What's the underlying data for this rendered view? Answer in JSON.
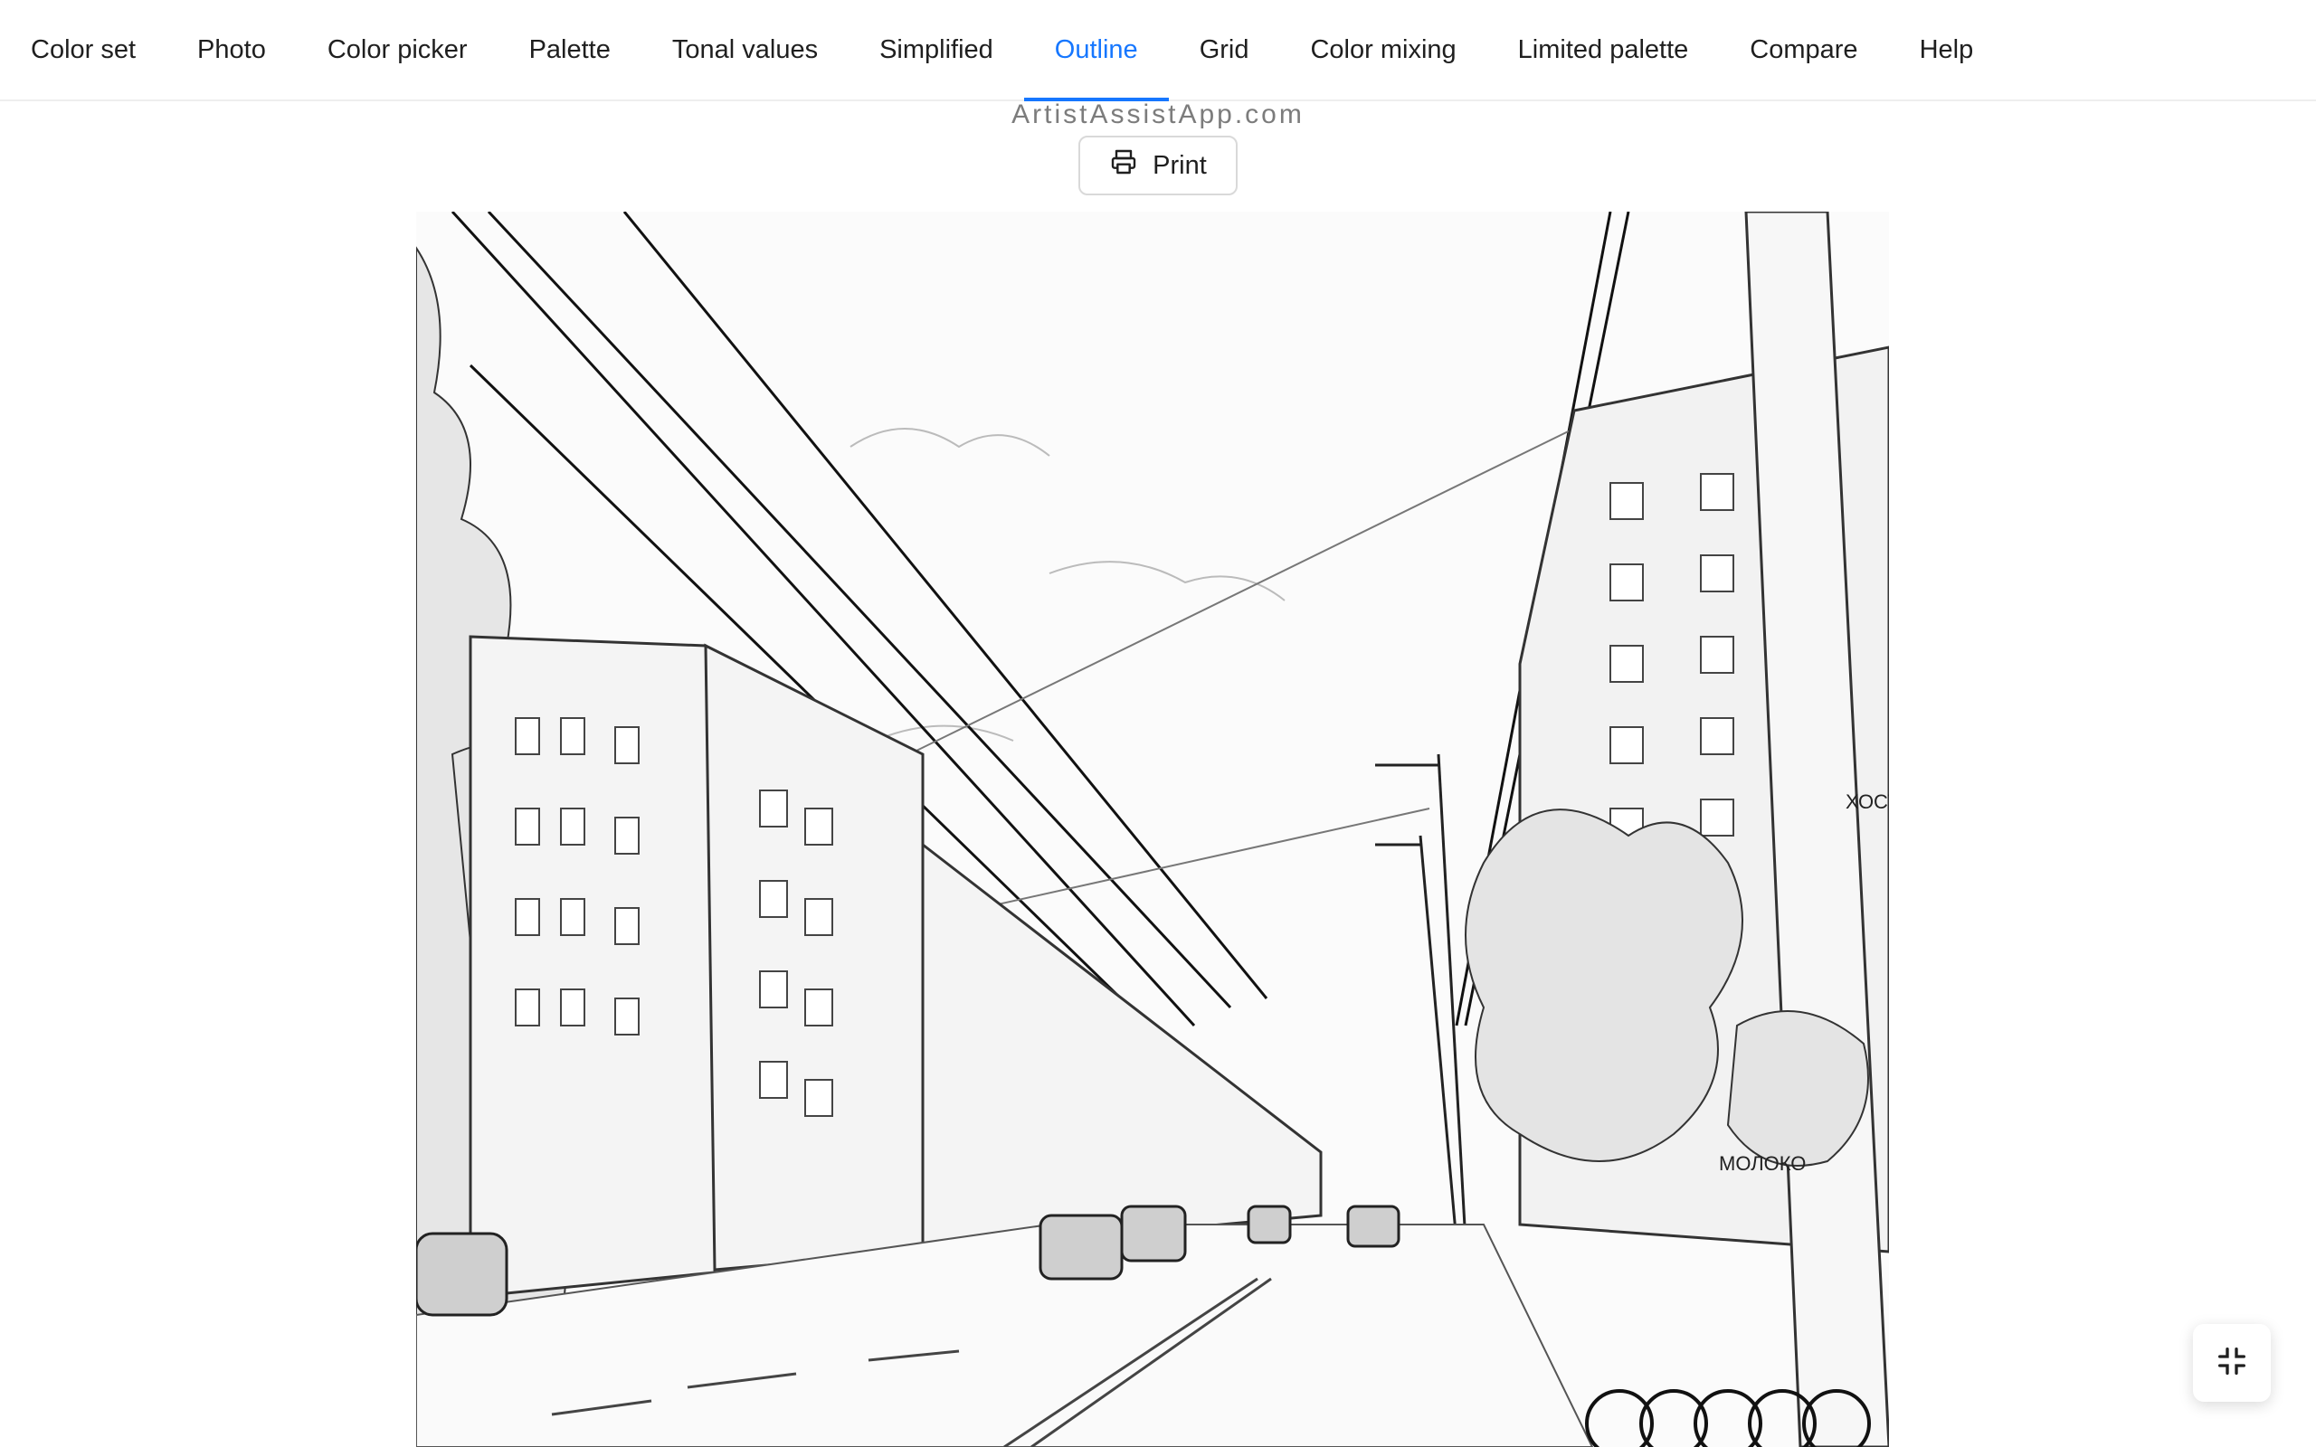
{
  "tabs": [
    {
      "label": "Color set"
    },
    {
      "label": "Photo"
    },
    {
      "label": "Color picker"
    },
    {
      "label": "Palette"
    },
    {
      "label": "Tonal values"
    },
    {
      "label": "Simplified"
    },
    {
      "label": "Outline",
      "active": true
    },
    {
      "label": "Grid"
    },
    {
      "label": "Color mixing"
    },
    {
      "label": "Limited palette"
    },
    {
      "label": "Compare"
    },
    {
      "label": "Help"
    }
  ],
  "watermark": "ArtistAssistApp.com",
  "print_button": {
    "label": "Print",
    "icon": "printer-icon"
  },
  "image": {
    "description_kind": "pencil-outline-sketch",
    "signs": [
      "ХОСТЕЛ",
      "МОЛОКО"
    ]
  },
  "fullscreen_button": {
    "icon": "exit-fullscreen-icon"
  },
  "colors": {
    "accent": "#1677ff",
    "text": "#1f1f1f",
    "muted": "#7c7c7c"
  }
}
